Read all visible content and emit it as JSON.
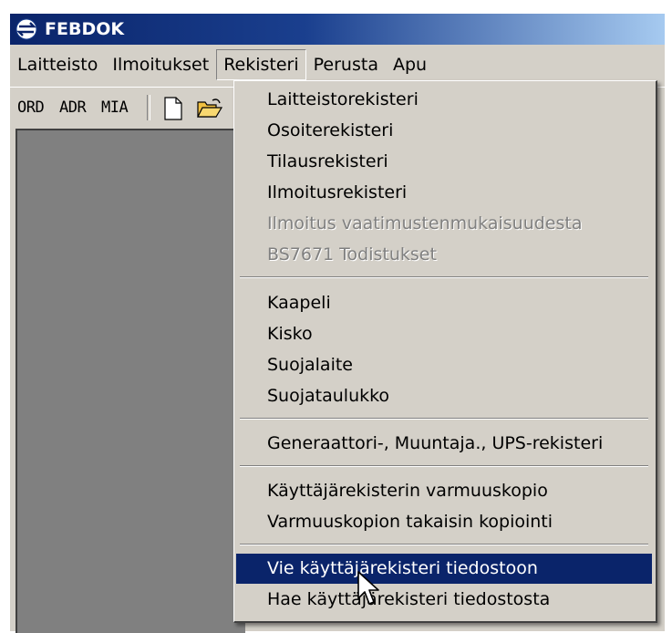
{
  "window": {
    "title": "FEBDOK",
    "app_icon": "febdok-logo-icon"
  },
  "menubar": {
    "items": [
      {
        "label": "Laitteisto"
      },
      {
        "label": "Ilmoitukset"
      },
      {
        "label": "Rekisteri"
      },
      {
        "label": "Perusta"
      },
      {
        "label": "Apu"
      }
    ],
    "open_menu": "Rekisteri"
  },
  "toolbar": {
    "buttons": [
      {
        "label": "ORD"
      },
      {
        "label": "ADR"
      },
      {
        "label": "MIA"
      }
    ],
    "icons": [
      "new-document-icon",
      "open-folder-icon"
    ]
  },
  "dropdown": {
    "groups": [
      [
        {
          "label": "Laitteistorekisteri",
          "enabled": true
        },
        {
          "label": "Osoiterekisteri",
          "enabled": true
        },
        {
          "label": "Tilausrekisteri",
          "enabled": true
        },
        {
          "label": "Ilmoitusrekisteri",
          "enabled": true
        },
        {
          "label": "Ilmoitus vaatimustenmukaisuudesta",
          "enabled": false
        },
        {
          "label": "BS7671 Todistukset",
          "enabled": false
        }
      ],
      [
        {
          "label": "Kaapeli",
          "enabled": true
        },
        {
          "label": "Kisko",
          "enabled": true
        },
        {
          "label": "Suojalaite",
          "enabled": true
        },
        {
          "label": "Suojataulukko",
          "enabled": true
        }
      ],
      [
        {
          "label": "Generaattori-, Muuntaja., UPS-rekisteri",
          "enabled": true
        }
      ],
      [
        {
          "label": "Käyttäjärekisterin varmuuskopio",
          "enabled": true
        },
        {
          "label": "Varmuuskopion takaisin kopiointi",
          "enabled": true
        }
      ],
      [
        {
          "label": "Vie käyttäjärekisteri tiedostoon",
          "enabled": true,
          "highlighted": true
        },
        {
          "label": "Hae käyttäjärekisteri tiedostosta",
          "enabled": true
        }
      ]
    ]
  },
  "colors": {
    "titlebar_start": "#0a246a",
    "titlebar_end": "#a6caf0",
    "menu_bg": "#d4d0c8",
    "highlight": "#0a246a",
    "disabled_text": "#808080",
    "workspace": "#808080"
  }
}
